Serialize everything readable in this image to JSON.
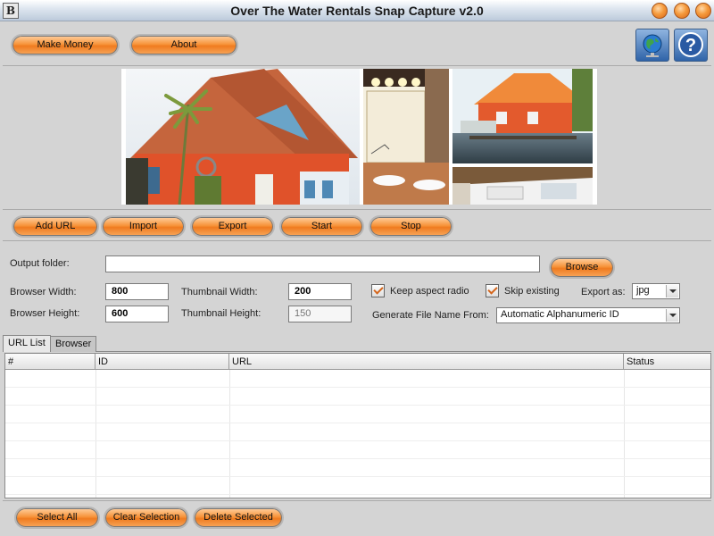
{
  "window": {
    "title": "Over The Water Rentals Snap Capture v2.0",
    "icon_letter": "B"
  },
  "header": {
    "make_money_label": "Make Money",
    "about_label": "About",
    "globe_icon": "globe-icon",
    "help_icon": "help-icon"
  },
  "toolbar": {
    "add_url_label": "Add URL",
    "import_label": "Import",
    "export_label": "Export",
    "start_label": "Start",
    "stop_label": "Stop"
  },
  "settings": {
    "output_folder_label": "Output folder:",
    "output_folder_value": "",
    "browse_label": "Browse",
    "browser_width_label": "Browser Width:",
    "browser_width_value": "800",
    "browser_height_label": "Browser Height:",
    "browser_height_value": "600",
    "thumb_width_label": "Thumbnail Width:",
    "thumb_width_value": "200",
    "thumb_height_label": "Thumbnail Height:",
    "thumb_height_value": "150",
    "keep_aspect_label": "Keep aspect radio",
    "keep_aspect_checked": true,
    "skip_existing_label": "Skip existing",
    "skip_existing_checked": true,
    "export_as_label": "Export as:",
    "export_as_value": "jpg",
    "gen_name_label": "Generate File Name From:",
    "gen_name_value": "Automatic Alphanumeric ID"
  },
  "tabs": [
    {
      "label": "URL List",
      "active": true
    },
    {
      "label": "Browser",
      "active": false
    }
  ],
  "table": {
    "columns": [
      "#",
      "ID",
      "URL",
      "Status"
    ],
    "rows": []
  },
  "bottom": {
    "select_all_label": "Select All",
    "clear_selection_label": "Clear Selection",
    "delete_selected_label": "Delete Selected"
  },
  "colors": {
    "accent_orange": "#f7943b",
    "chrome_gray": "#d4d4d4",
    "title_gradient_bottom": "#bccadb"
  }
}
